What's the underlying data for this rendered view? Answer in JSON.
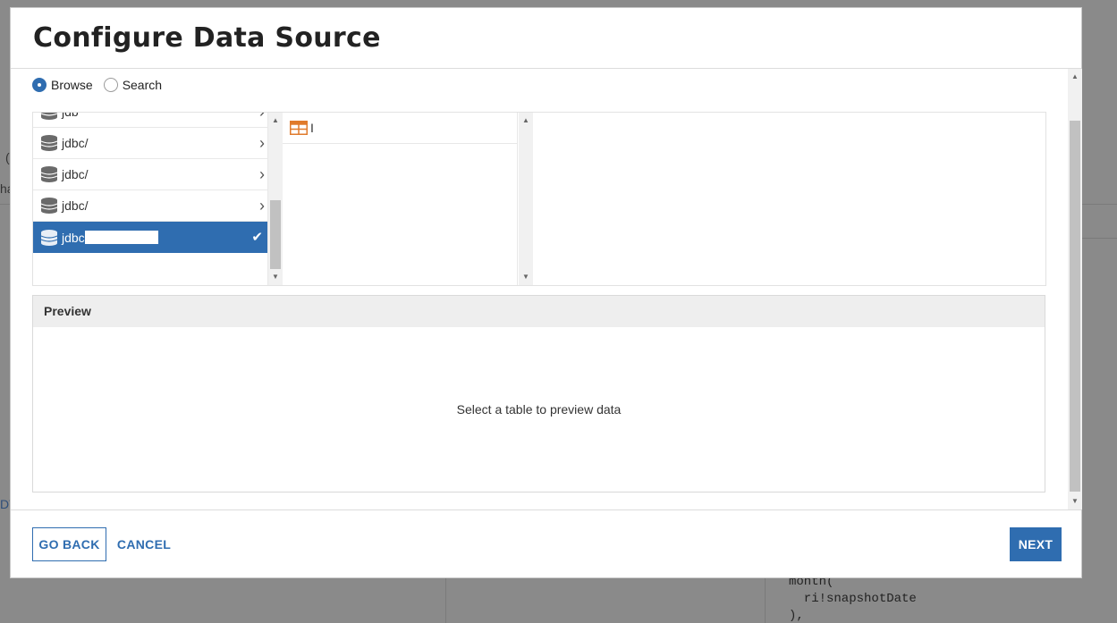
{
  "dialog": {
    "title": "Configure Data Source",
    "mode_options": [
      {
        "label": "Browse",
        "selected": true
      },
      {
        "label": "Search",
        "selected": false
      }
    ],
    "datasources": [
      {
        "label": "jdb",
        "selected": false,
        "partial": true
      },
      {
        "label": "jdbc/",
        "selected": false
      },
      {
        "label": "jdbc/",
        "selected": false
      },
      {
        "label": "jdbc/",
        "selected": false
      },
      {
        "label": "jdbc",
        "selected": true
      }
    ],
    "tables": [
      {
        "label": "I"
      }
    ],
    "preview": {
      "heading": "Preview",
      "empty_message": "Select a table to preview data"
    },
    "footer": {
      "go_back_label": "GO BACK",
      "cancel_label": "CANCEL",
      "next_label": "NEXT"
    }
  },
  "background": {
    "code_lines": [
      "month(",
      "  ri!snapshotDate",
      "),"
    ],
    "fragments": [
      "(",
      "ha",
      "DT"
    ]
  },
  "colors": {
    "accent": "#2f6db0",
    "table_icon": "#e07b2c",
    "overlay": "#7f7f7f"
  }
}
